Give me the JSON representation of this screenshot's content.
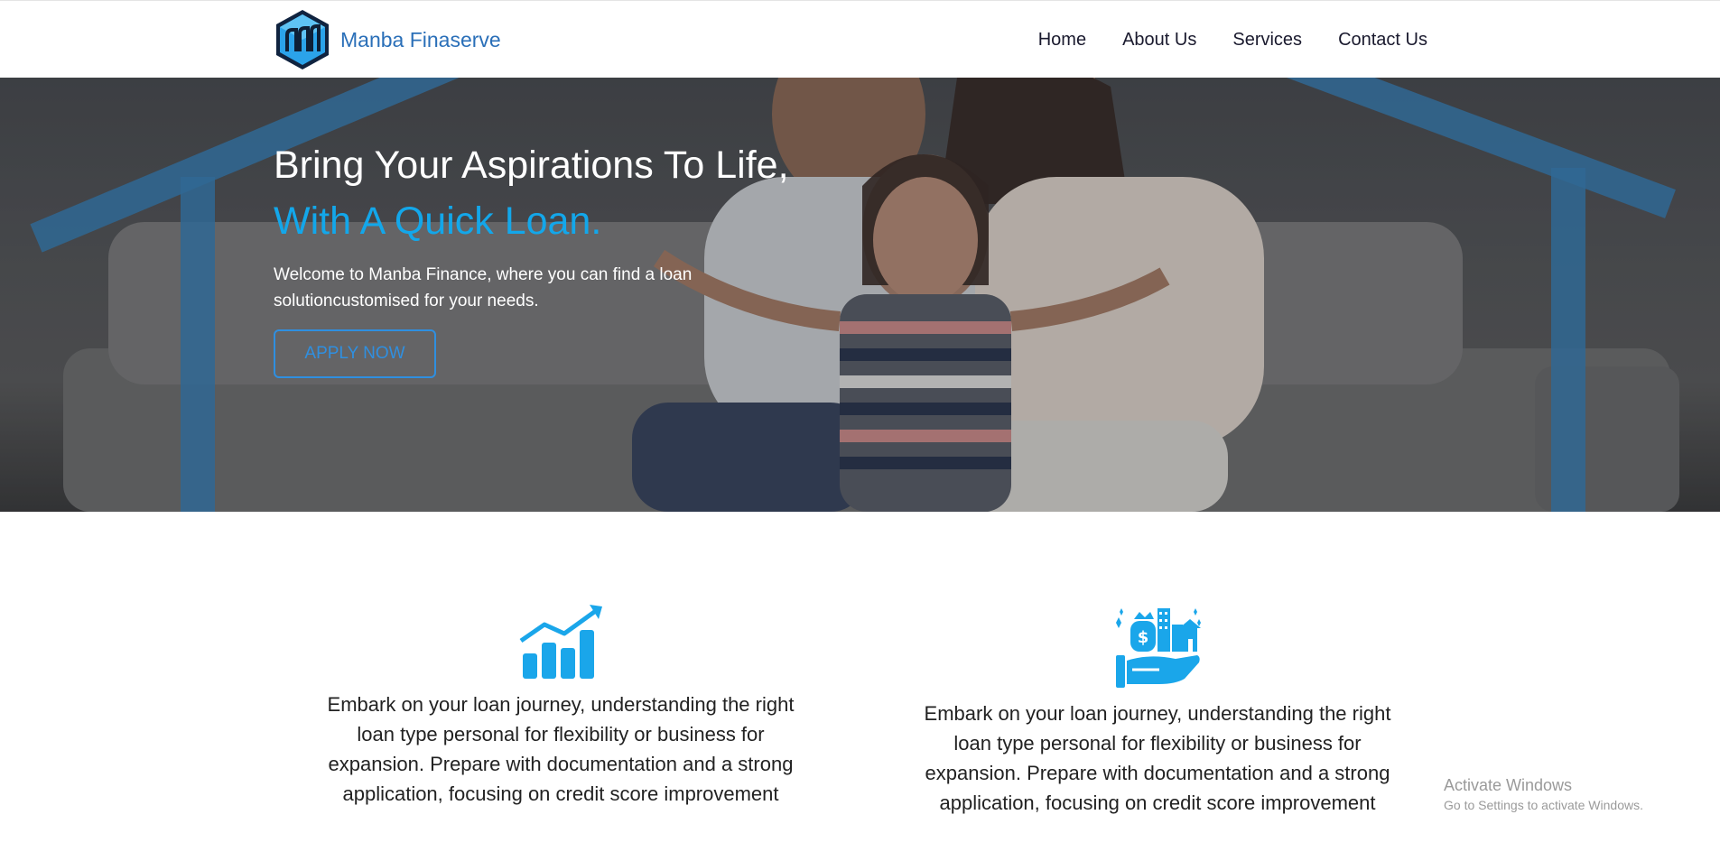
{
  "brand": {
    "name": "Manba Finaserve",
    "logo_icon": "hexagon-bars-logo-icon",
    "color": "#2a6fb8"
  },
  "nav": {
    "items": [
      {
        "label": "Home"
      },
      {
        "label": "About Us"
      },
      {
        "label": "Services"
      },
      {
        "label": "Contact Us"
      }
    ]
  },
  "hero": {
    "title_line1": "Bring Your Aspirations To Life,",
    "title_line2": "With A Quick Loan.",
    "description": "Welcome to Manba Finance, where you can find a loan solutioncustomised for your needs.",
    "cta_label": "APPLY NOW",
    "accent_color": "#13a7ea"
  },
  "features": [
    {
      "icon": "bar-chart-growth-icon",
      "text": "Embark on your loan journey, understanding the right loan type personal for flexibility or business for expansion. Prepare with documentation and a strong application, focusing on credit score improvement"
    },
    {
      "icon": "hand-holding-assets-icon",
      "text": "Embark on your loan journey, understanding the right loan type personal for flexibility or business for expansion. Prepare with documentation and a strong application, focusing on credit score improvement"
    }
  ],
  "watermark": {
    "title": "Activate Windows",
    "subtitle": "Go to Settings to activate Windows."
  }
}
